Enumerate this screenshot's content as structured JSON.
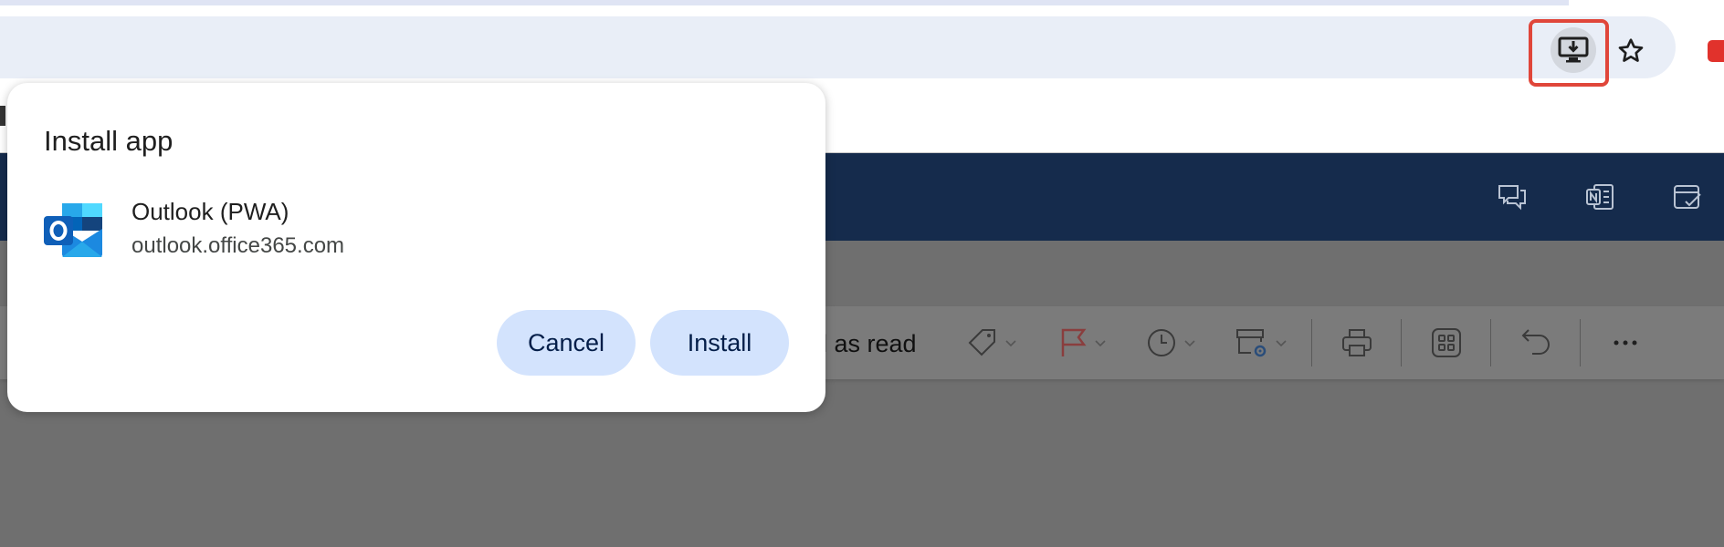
{
  "browser": {
    "toolbar_icons": [
      "install-app-icon",
      "star-icon",
      "youtube-extension-icon"
    ]
  },
  "outlook": {
    "command_bar": {
      "mark_read_partial": "ll as read",
      "icons": [
        "tag-icon",
        "flag-icon",
        "clock-icon",
        "archive-settings-icon",
        "print-icon",
        "apps-grid-icon",
        "undo-icon",
        "more-icon"
      ]
    },
    "header_icons": [
      "chat-icon",
      "onenote-icon",
      "todo-icon"
    ]
  },
  "dialog": {
    "title": "Install app",
    "app_name": "Outlook (PWA)",
    "app_origin": "outlook.office365.com",
    "cancel_label": "Cancel",
    "install_label": "Install"
  },
  "colors": {
    "outlook_header": "#152b4c",
    "dialog_button_bg": "#d3e3fd",
    "highlight": "#e0463a"
  }
}
